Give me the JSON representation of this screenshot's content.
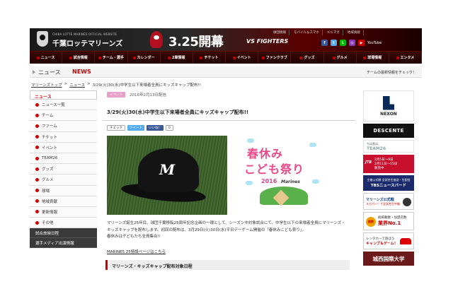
{
  "header": {
    "site_subtitle": "CHIBA LOTTE MARINES OFFICIAL WEBSITE",
    "site_name": "千葉ロッテマリーンズ",
    "opening_date": "3.25開幕",
    "opening_vs": "VS FIGHTERS",
    "util_links": [
      "球団情報",
      "モバイル＆スマホ",
      "メルマガ",
      "地域貢献"
    ],
    "social": [
      {
        "icon": "facebook-icon",
        "glyph": "f",
        "color": "#3b5998",
        "label": ""
      },
      {
        "icon": "twitter-icon",
        "glyph": "t",
        "color": "#55acee",
        "label": ""
      },
      {
        "icon": "line-icon",
        "glyph": "L",
        "color": "#00b900",
        "label": ""
      },
      {
        "icon": "instagram-icon",
        "glyph": "◎",
        "color": "#8a3ab9",
        "label": ""
      },
      {
        "icon": "youtube-icon",
        "glyph": "▶",
        "color": "#cc0000",
        "label": "YouTube"
      }
    ],
    "nav": [
      "ニュース",
      "試合情報",
      "チーム・選手",
      "カレンダー",
      "2軍情報",
      "チケット",
      "イベント",
      "ファンクラブ",
      "グッズ",
      "グルメ",
      "球場情報",
      "エンタメ"
    ]
  },
  "news_bar": {
    "title_jp": "ニュース",
    "title_en": "NEWS",
    "check_text": "チームの最新情報をチェック！"
  },
  "breadcrumb": {
    "home": "マリーンズトップ",
    "section": "ニュース",
    "sep": ">",
    "current": "3/29(火)30(水)中学生以下来場者全員にキッズキャップ配布!!"
  },
  "sidebar": {
    "heading": "ニュース",
    "items": [
      "ニュース一覧",
      "チーム",
      "ファーム",
      "チケット",
      "イベント",
      "TEAM26",
      "グッズ",
      "グルメ",
      "球場",
      "地域貢献",
      "更新情報",
      "その他"
    ],
    "extra": [
      "試合放映日程",
      "選手メディア出演情報"
    ]
  },
  "article": {
    "tag": "イベント",
    "date": "2016年2月13日配信",
    "title": "3/29(火)30(水)中学生以下来場者全員にキッズキャップ配布!!",
    "share": {
      "check": "チェック",
      "tweet": "ツイート",
      "like": "いいね！",
      "like_count": "0"
    },
    "festival": {
      "line1": "春休み",
      "line2": "こども祭り",
      "year": "2016",
      "team": "Marines"
    },
    "body": [
      "マリーンズ誕生25年目、球団千葉移転25周年記念企画の一環として、シーズン中対象試合にて、中学生以下の来場者全員にマリーンズ・",
      "キッズキャップを配布します。初回の配布は、3月29日(火)30日(水)平日デーゲーム開催の「春休みこども祭り」。",
      "春休みは子どもたち全員集合!!"
    ],
    "link": "MARINES 25特設ページはこちら",
    "section_heading": "マリーンズ・キッズキャップ配布対象日程"
  },
  "ads": {
    "nexon": "NEXON",
    "descente": "DESCENTE",
    "team26_a": "ちば県は、",
    "team26_b": "TEAM26",
    "jtb_logo": "JTB",
    "jtb_a": "2月5日～9日",
    "jtb_b": "2月11日～15日",
    "jtb_c": "販売中",
    "tbs_a": "主催公式戦 全試合生放送・生配信",
    "tbs_b": "TBSニュースバード",
    "sky_a": "マリーンズ公式戦",
    "sky_b": "スカパー！で全試合生中継",
    "job_badge": "総数",
    "job_a": "総掲載数・加盟店数",
    "job_b": "業界No.1",
    "rent_a": "レンタカーで遊ぼう",
    "rent_b": "キャンプ＆ゲーム！",
    "josai": "城西国際大学"
  }
}
